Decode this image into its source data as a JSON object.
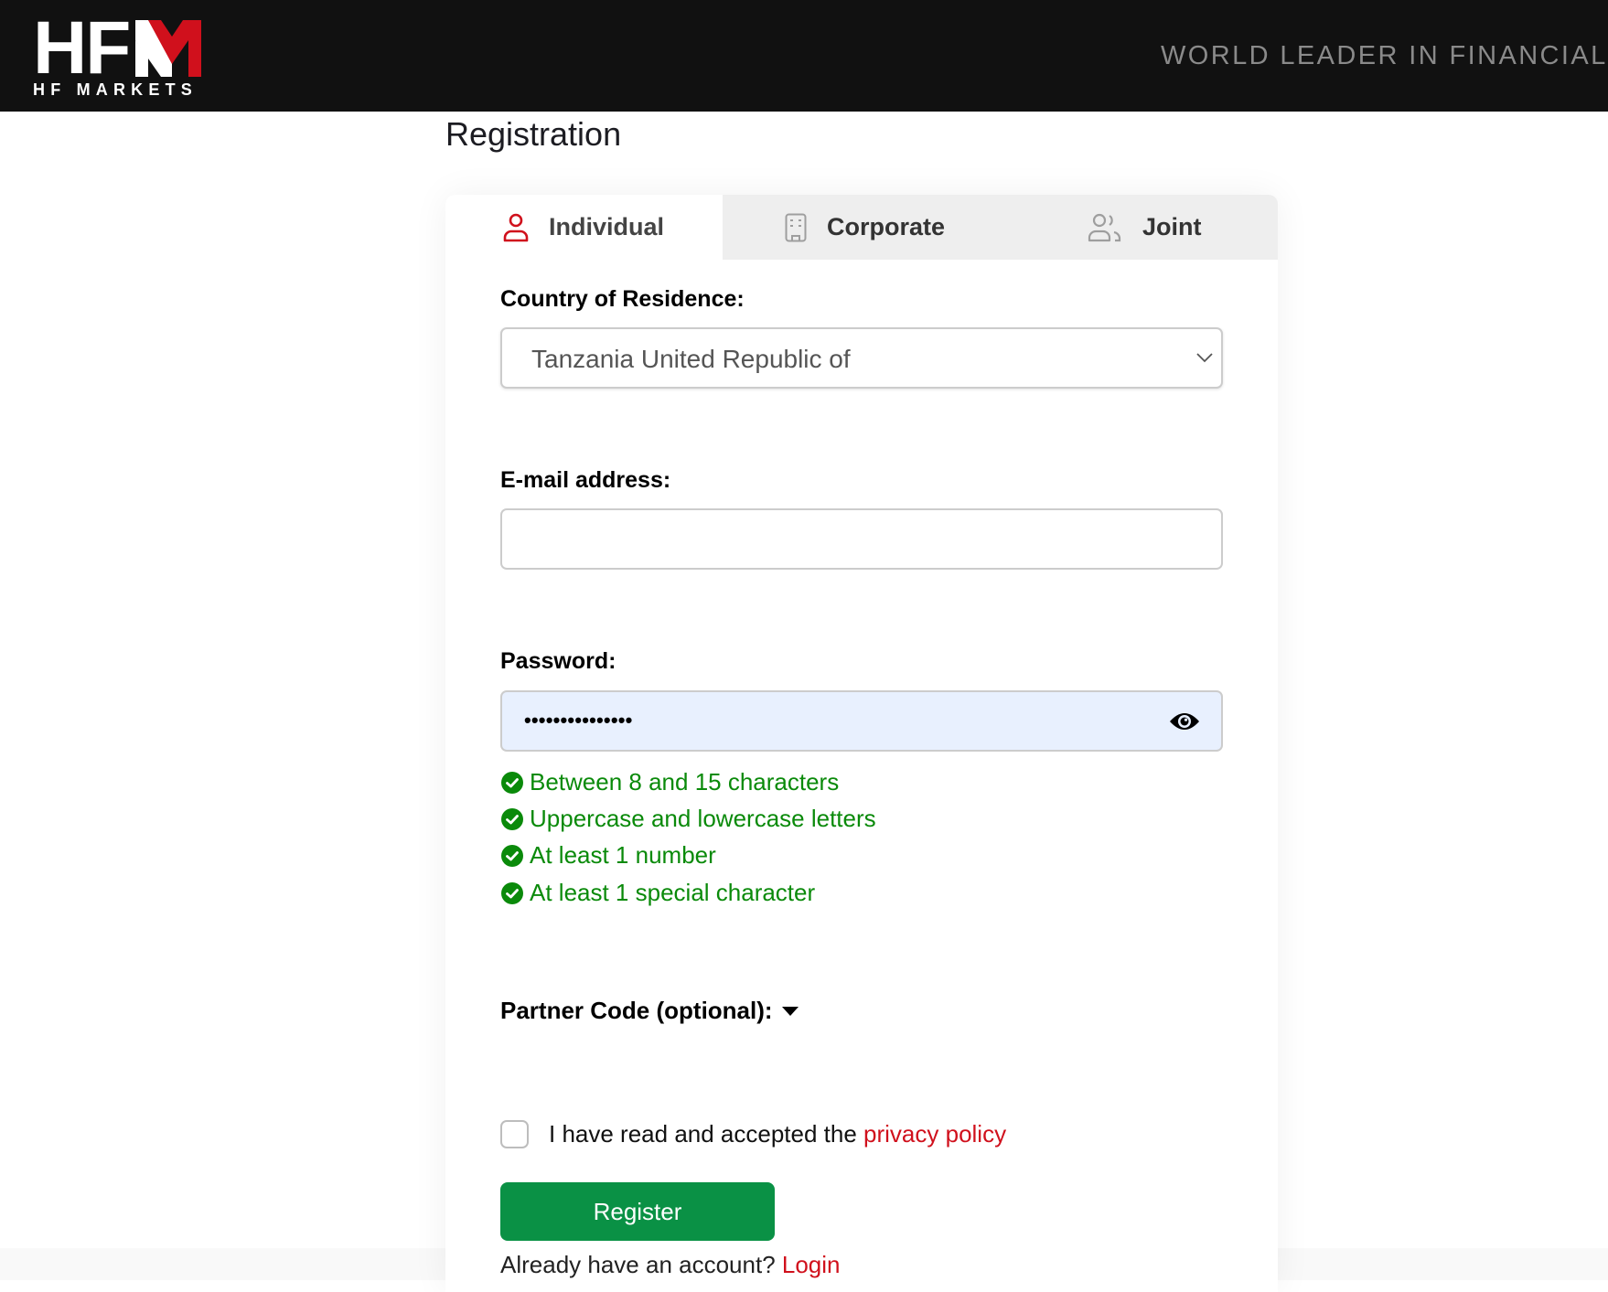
{
  "header": {
    "logo": {
      "mark": "HFM",
      "subtitle": "HF MARKETS",
      "accent_color": "#d0101c"
    },
    "tagline": "WORLD LEADER IN FINANCIAL T"
  },
  "page": {
    "title": "Registration"
  },
  "tabs": [
    {
      "label": "Individual",
      "icon": "person-icon",
      "active": true
    },
    {
      "label": "Corporate",
      "icon": "building-icon",
      "active": false
    },
    {
      "label": "Joint",
      "icon": "users-icon",
      "active": false
    }
  ],
  "form": {
    "country": {
      "label": "Country of Residence:",
      "value": "Tanzania United Republic of"
    },
    "email": {
      "label": "E-mail address:",
      "value": "",
      "placeholder": ""
    },
    "password": {
      "label": "Password:",
      "masked_value": "•••••••••••••••",
      "length": 15
    },
    "requirements": [
      {
        "text": "Between 8 and 15 characters",
        "met": true
      },
      {
        "text": "Uppercase and lowercase letters",
        "met": true
      },
      {
        "text": "At least 1 number",
        "met": true
      },
      {
        "text": "At least 1 special character",
        "met": true
      }
    ],
    "partner_code": {
      "label": "Partner Code (optional):"
    },
    "consent": {
      "text": "I have read and accepted the ",
      "link": "privacy policy",
      "checked": false
    },
    "register_label": "Register",
    "login_prompt": "Already have an account? ",
    "login_link": "Login"
  },
  "colors": {
    "header_bg": "#111111",
    "brand_red": "#d0101c",
    "success_green": "#0a8a0a",
    "button_green": "#0a9145",
    "autofill_bg": "#e8f0fe"
  }
}
